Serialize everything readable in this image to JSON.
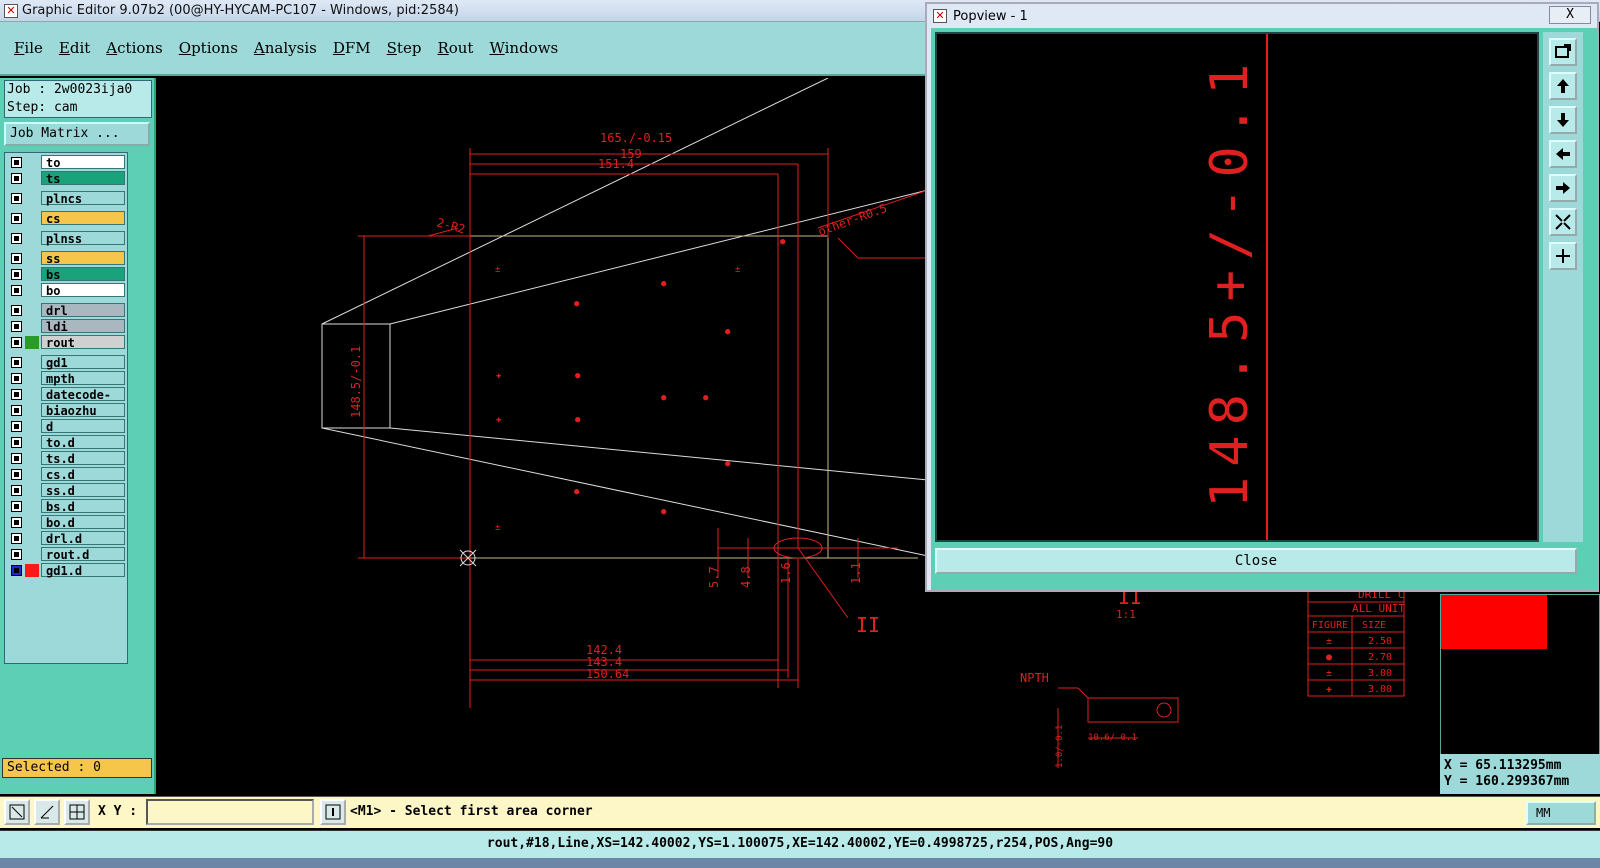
{
  "window": {
    "title": "Graphic Editor 9.07b2 (00@HY-HYCAM-PC107 - Windows, pid:2584)"
  },
  "menu": [
    "File",
    "Edit",
    "Actions",
    "Options",
    "Analysis",
    "DFM",
    "Step",
    "Rout",
    "Windows"
  ],
  "job": {
    "job_line": "Job : 2w0023ija0",
    "step_line": "Step: cam",
    "matrix_button": "Job Matrix ..."
  },
  "layers": [
    {
      "name": "to",
      "color": "#ffffff"
    },
    {
      "name": "ts",
      "color": "#1aa37a"
    },
    {
      "name": "plncs",
      "color": "#9ed9d9"
    },
    {
      "name": "cs",
      "color": "#f5c64a"
    },
    {
      "name": "plnss",
      "color": "#9ed9d9"
    },
    {
      "name": "ss",
      "color": "#f5c64a"
    },
    {
      "name": "bs",
      "color": "#1aa37a"
    },
    {
      "name": "bo",
      "color": "#ffffff"
    },
    {
      "name": "drl",
      "color": "#a9b8c0"
    },
    {
      "name": "ldi",
      "color": "#a9b8c0"
    },
    {
      "name": "rout",
      "color": "#d0d0d0"
    },
    {
      "name": "gd1",
      "color": "#9ed9d9"
    },
    {
      "name": "mpth",
      "color": "#9ed9d9"
    },
    {
      "name": "datecode-to",
      "color": "#9ed9d9"
    },
    {
      "name": "biaozhu",
      "color": "#9ed9d9"
    },
    {
      "name": "d",
      "color": "#9ed9d9"
    },
    {
      "name": "to.d",
      "color": "#9ed9d9"
    },
    {
      "name": "ts.d",
      "color": "#9ed9d9"
    },
    {
      "name": "cs.d",
      "color": "#9ed9d9"
    },
    {
      "name": "ss.d",
      "color": "#9ed9d9"
    },
    {
      "name": "bs.d",
      "color": "#9ed9d9"
    },
    {
      "name": "bo.d",
      "color": "#9ed9d9"
    },
    {
      "name": "drl.d",
      "color": "#9ed9d9"
    },
    {
      "name": "rout.d",
      "color": "#9ed9d9"
    },
    {
      "name": "gd1.d",
      "color": "#9ed9d9"
    }
  ],
  "selected_label": "Selected : 0",
  "canvas_labels": {
    "dim1": "165./-0.15",
    "dim2": "159",
    "dim3": "151.4",
    "r2": "2-R2",
    "other": "other-R0.5",
    "vdim": "148.5/-0.1",
    "b1": "142.4",
    "b2": "143.4",
    "b3": "150.64",
    "v57": "5.7",
    "v48": "4.8",
    "v16": "1.6",
    "v11": "1.1",
    "roman": "II",
    "detail": "II",
    "scale": "1:1",
    "npth": "NPTH",
    "n1": "1.0/-0.1",
    "n2": "10.6/-0.1"
  },
  "drill_table": {
    "title": "DRILL C",
    "units": "ALL UNIT",
    "headers": [
      "FIGURE",
      "SIZE"
    ],
    "rows": [
      "2.50",
      "2.70",
      "3.00",
      "3.00"
    ]
  },
  "popview": {
    "title": "Popview - 1",
    "close_x": "X",
    "zoom_text": "148.5+/-0.1",
    "close_button": "Close"
  },
  "coords": {
    "x": "X = 65.113295mm",
    "y": "Y = 160.299367mm"
  },
  "bottom": {
    "xy_label": "X Y :",
    "xy_value": "",
    "prompt": "<M1> - Select first area corner",
    "unit": "MM"
  },
  "status": "rout,#18,Line,XS=142.40002,YS=1.100075,XE=142.40002,YE=0.4998725,r254,POS,Ang=90"
}
